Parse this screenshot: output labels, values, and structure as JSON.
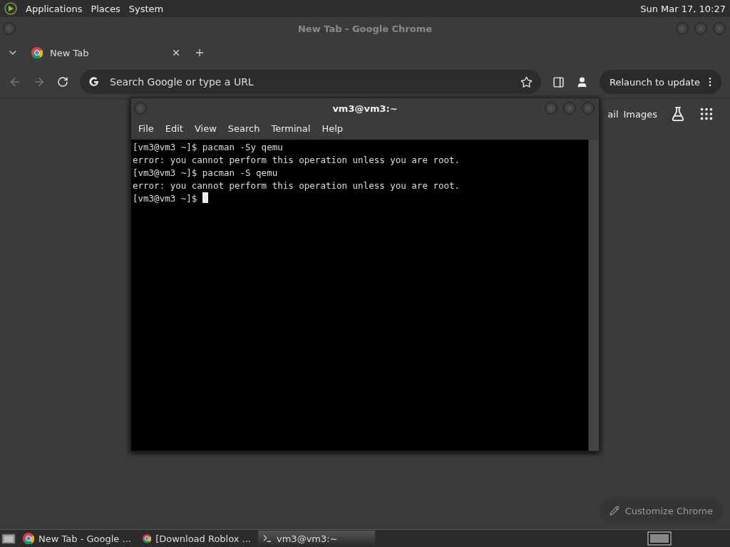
{
  "top_panel": {
    "menus": [
      "Applications",
      "Places",
      "System"
    ],
    "clock": "Sun Mar 17, 10:27"
  },
  "chrome": {
    "title": "New Tab - Google Chrome",
    "tabs": [
      {
        "label": "New Tab",
        "selected": true
      }
    ],
    "omnibox": {
      "placeholder": "Search Google or type a URL"
    },
    "relaunch": "Relaunch to update",
    "ntp_links": [
      "ail",
      "Images"
    ],
    "customize": "Customize Chrome"
  },
  "terminal": {
    "title": "vm3@vm3:~",
    "menus": [
      "File",
      "Edit",
      "View",
      "Search",
      "Terminal",
      "Help"
    ],
    "lines": [
      "[vm3@vm3 ~]$ pacman -Sy qemu",
      "error: you cannot perform this operation unless you are root.",
      "[vm3@vm3 ~]$ pacman -S qemu",
      "error: you cannot perform this operation unless you are root.",
      "[vm3@vm3 ~]$ "
    ]
  },
  "taskbar": {
    "items": [
      {
        "label": "New Tab - Google ...",
        "kind": "chrome",
        "selected": false
      },
      {
        "label": "[Download Roblox ...",
        "kind": "chrome",
        "selected": false
      },
      {
        "label": "vm3@vm3:~",
        "kind": "terminal",
        "selected": true
      }
    ]
  }
}
